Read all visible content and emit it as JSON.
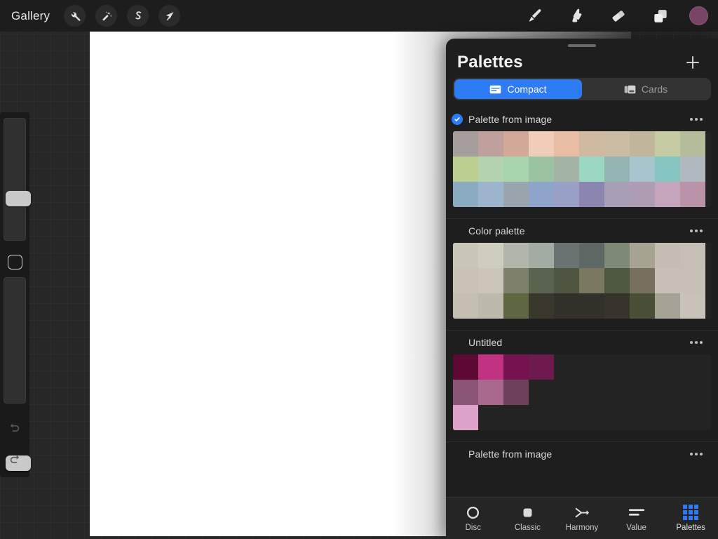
{
  "app": {
    "gallery_label": "Gallery",
    "top_tools_left": [
      {
        "name": "actions-wrench-icon",
        "label": "Actions"
      },
      {
        "name": "adjustments-wand-icon",
        "label": "Adjustments"
      },
      {
        "name": "selection-icon",
        "label": "Selection"
      },
      {
        "name": "transform-arrow-icon",
        "label": "Transform"
      }
    ],
    "top_tools_right": [
      {
        "name": "paint-brush-icon",
        "label": "Paint"
      },
      {
        "name": "smudge-icon",
        "label": "Smudge"
      },
      {
        "name": "eraser-icon",
        "label": "Erase"
      },
      {
        "name": "layers-icon",
        "label": "Layers"
      }
    ],
    "current_color": "#7a4466"
  },
  "sidebar": {
    "brush_size_label": "Brush size",
    "brush_opacity_label": "Brush opacity",
    "modify_label": "Modify",
    "undo_label": "Undo",
    "redo_label": "Redo"
  },
  "panel": {
    "title": "Palettes",
    "add_label": "+",
    "segments": [
      {
        "label": "Compact",
        "icon": "compact-card-icon",
        "active": true
      },
      {
        "label": "Cards",
        "icon": "cards-icon",
        "active": false
      }
    ]
  },
  "palettes": [
    {
      "name": "Palette from image",
      "selected": true,
      "menu_label": "More options",
      "rows": [
        [
          "#a69e9d",
          "#c0a09d",
          "#d2a899",
          "#efcdb9",
          "#e9bda4",
          "#cfbaa1",
          "#cbbca4",
          "#bfb69b",
          "#c6cba3",
          "#b3bd9c"
        ],
        [
          "#bbcf91",
          "#b3d3ad",
          "#a7d6ae",
          "#9cc2a4",
          "#a3b3a5",
          "#9ad8c3",
          "#92b5b2",
          "#a8c4cc",
          "#86c4c2",
          "#b0b8c0"
        ],
        [
          "#8aabc0",
          "#9cb4cd",
          "#9aa5ae",
          "#8fa4cb",
          "#9aa1c6",
          "#8b86b0",
          "#a79fb6",
          "#ad9cb2",
          "#c4a5bb",
          "#bb93a8"
        ]
      ]
    },
    {
      "name": "Color palette",
      "selected": false,
      "menu_label": "More options",
      "rows": [
        [
          "#c9c5b8",
          "#cfccc0",
          "#b2b5aa",
          "#a3aca2",
          "#6b7372",
          "#5d6763",
          "#7e8a77",
          "#a8a493",
          "#c5bdb3",
          "#c5bfb5"
        ],
        [
          "#c8c3b6",
          "#cbc5ba",
          "#7e806c",
          "#5a6350",
          "#4e5540",
          "#7b7862",
          "#4e5740",
          "#77705f",
          "#c7c0b6",
          "#c6c0b6"
        ],
        [
          "#c5bfb3",
          "#bdbaac",
          "#5e6642",
          "#3a372d",
          "#33302a",
          "#33302a",
          "#37342c",
          "#4a5037",
          "#a7a296",
          "#c8c2b8"
        ]
      ]
    },
    {
      "name": "Untitled",
      "selected": false,
      "menu_label": "More options",
      "rows": [
        [
          "#5c0a34",
          "#c13283",
          "#771250",
          "#6d1b4e",
          null,
          null,
          null,
          null,
          null,
          null
        ],
        [
          "#8a5574",
          "#a9698f",
          "#6c4159",
          null,
          null,
          null,
          null,
          null,
          null,
          null
        ],
        [
          "#dea3ca",
          null,
          null,
          null,
          null,
          null,
          null,
          null,
          null,
          null
        ]
      ]
    },
    {
      "name": "Palette from image",
      "selected": false,
      "menu_label": "More options",
      "rows": []
    }
  ],
  "tabs": [
    {
      "label": "Disc",
      "icon": "disc-icon",
      "active": false
    },
    {
      "label": "Classic",
      "icon": "classic-square-icon",
      "active": false
    },
    {
      "label": "Harmony",
      "icon": "harmony-icon",
      "active": false
    },
    {
      "label": "Value",
      "icon": "value-sliders-icon",
      "active": false
    },
    {
      "label": "Palettes",
      "icon": "palettes-grid-icon",
      "active": true
    }
  ],
  "colors": {
    "accent": "#2e7bf6",
    "panel_bg": "#1e1e1e",
    "toolbar_bg": "#1d1d1d"
  }
}
